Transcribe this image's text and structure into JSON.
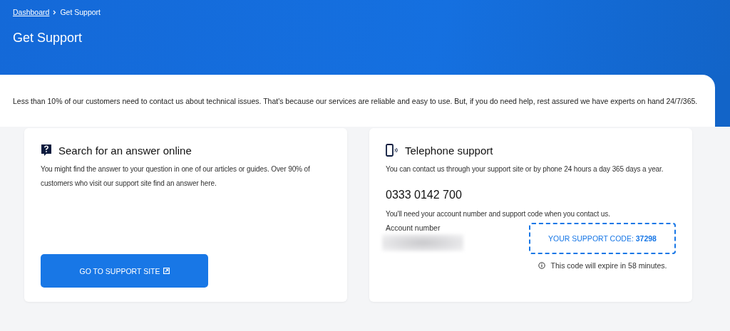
{
  "breadcrumb": [
    {
      "label": "Dashboard",
      "link": true
    },
    {
      "label": "Get Support",
      "link": false
    }
  ],
  "page_title": "Get Support",
  "intro": "Less than 10% of our customers need to contact us about technical issues. That's because our services are reliable and easy to use. But, if you do need help, rest assured we have experts on hand 24/7/365.",
  "cards": [
    {
      "kind": "online",
      "title": "Search for an answer online",
      "text": "You might find the answer to your question in one of our articles or guides. Over 90% of customers who visit our support site find an answer here.",
      "button": "GO TO SUPPORT SITE"
    },
    {
      "kind": "phone",
      "title": "Telephone support",
      "text": "You can contact us through your support site or by phone 24 hours a day 365 days a year.",
      "phone": "0333 0142 700",
      "note": "You'll need your account number and support code when you contact us.",
      "account_label": "Account number",
      "support_code": "YOUR SUPPORT CODE: **37298**",
      "expiry": "This code will expire in 58 minutes."
    }
  ]
}
